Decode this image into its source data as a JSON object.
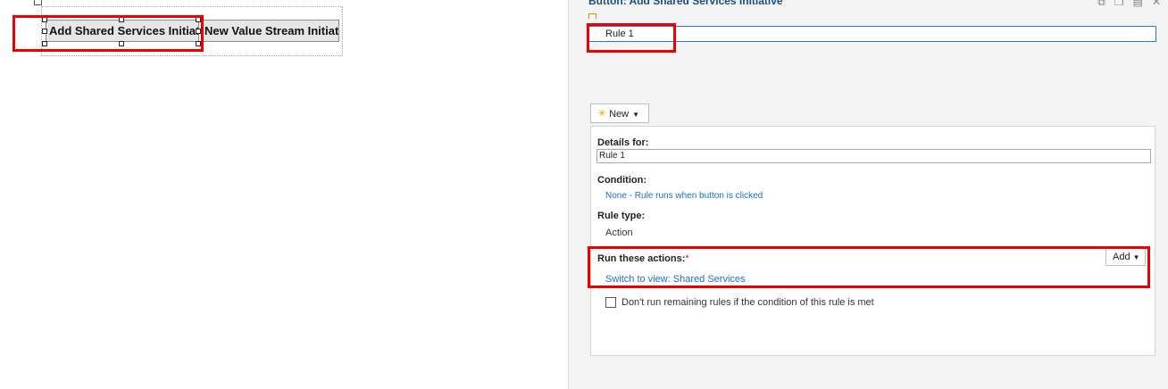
{
  "canvas": {
    "button1_label": "Add Shared Services Initiative",
    "button2_label": "New Value Stream Initiative"
  },
  "pane": {
    "title": "Button: Add Shared Services Initiative",
    "rules": [
      {
        "label": "Rule 1"
      }
    ],
    "new_button": "New",
    "details_label": "Details for:",
    "details_value": "Rule 1",
    "condition_label": "Condition:",
    "condition_value": "None - Rule runs when button is clicked",
    "rule_type_label": "Rule type:",
    "rule_type_value": "Action",
    "actions_label": "Run these actions:",
    "required_mark": "*",
    "add_button": "Add",
    "action_item": "Switch to view: Shared Services",
    "checkbox_label": "Don't run remaining rules if the condition of this rule is met"
  },
  "colors": {
    "highlight": "#ee0000",
    "link": "#1a6dc2",
    "selection_border": "#2a7ac0"
  }
}
